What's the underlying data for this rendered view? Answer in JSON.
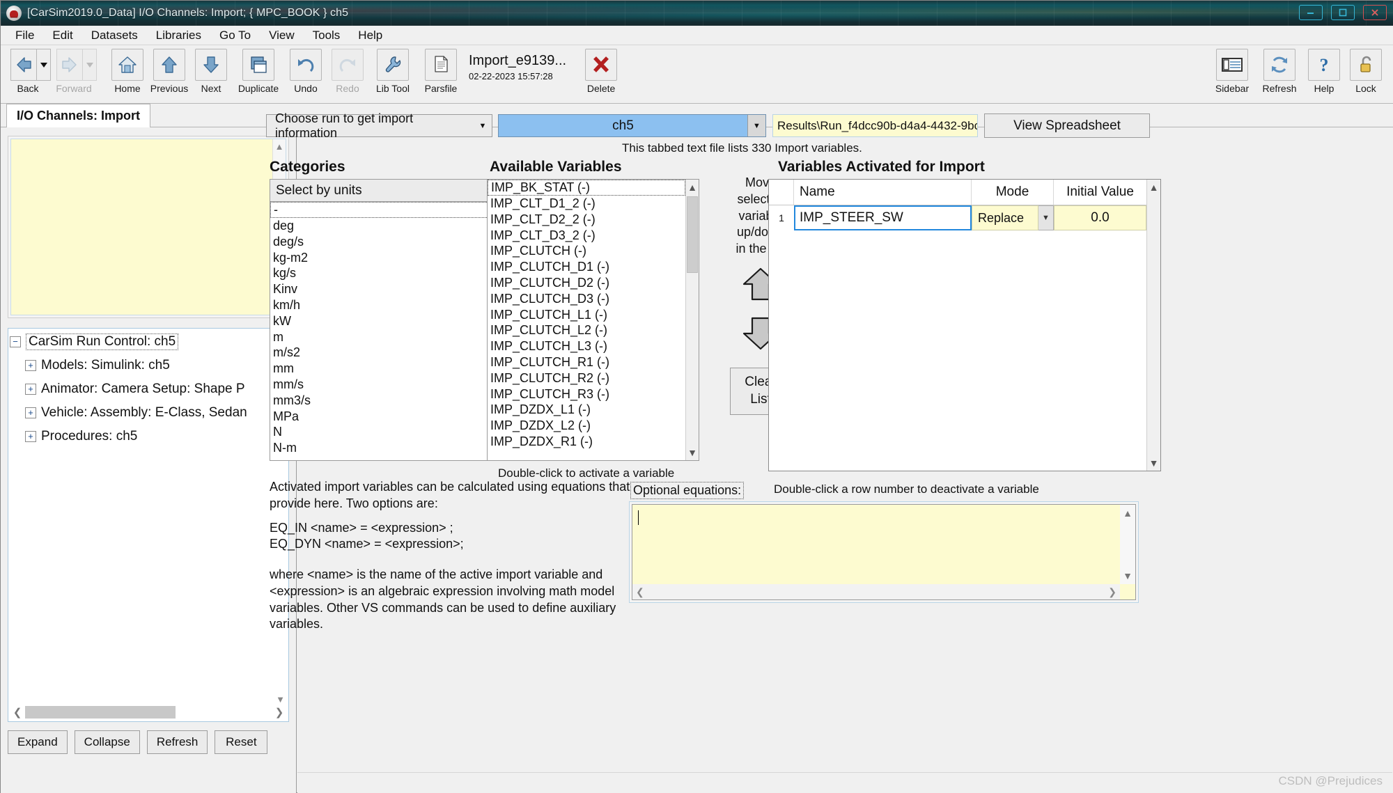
{
  "window": {
    "title": "[CarSim2019.0_Data] I/O Channels: Import; { MPC_BOOK } ch5",
    "app_icon": "carsim-logo-icon",
    "controls": [
      {
        "name": "minimize-button",
        "glyph": "minimize-icon"
      },
      {
        "name": "maximize-button",
        "glyph": "maximize-icon"
      },
      {
        "name": "close-button",
        "glyph": "close-icon"
      }
    ]
  },
  "menubar": [
    {
      "label": "File"
    },
    {
      "label": "Edit"
    },
    {
      "label": "Datasets"
    },
    {
      "label": "Libraries"
    },
    {
      "label": "Go To"
    },
    {
      "label": "View"
    },
    {
      "label": "Tools"
    },
    {
      "label": "Help"
    }
  ],
  "toolbar": {
    "left_buttons": [
      {
        "label": "Back",
        "icon": "arrow-left-icon",
        "enabled": true,
        "split": true
      },
      {
        "label": "Forward",
        "icon": "arrow-right-icon",
        "enabled": false,
        "split": true
      },
      {
        "label": "Home",
        "icon": "home-icon",
        "enabled": true
      },
      {
        "label": "Previous",
        "icon": "arrow-up-icon",
        "enabled": true
      },
      {
        "label": "Next",
        "icon": "arrow-down-icon",
        "enabled": true
      },
      {
        "label": "Duplicate",
        "icon": "duplicate-icon",
        "enabled": true
      },
      {
        "label": "Undo",
        "icon": "undo-icon",
        "enabled": true
      },
      {
        "label": "Redo",
        "icon": "redo-icon",
        "enabled": false
      },
      {
        "label": "Lib Tool",
        "icon": "wrench-icon",
        "enabled": true
      },
      {
        "label": "Parsfile",
        "icon": "document-icon",
        "enabled": true
      }
    ],
    "parsfile": {
      "name": "Import_e9139...",
      "timestamp": "02-22-2023 15:57:28"
    },
    "delete_button": {
      "label": "Delete",
      "icon": "red-x-icon"
    },
    "right_buttons": [
      {
        "label": "Sidebar",
        "icon": "sidebar-icon"
      },
      {
        "label": "Refresh",
        "icon": "refresh-icon"
      },
      {
        "label": "Help",
        "icon": "question-mark-icon"
      },
      {
        "label": "Lock",
        "icon": "padlock-icon"
      }
    ]
  },
  "tab": {
    "label": "I/O Channels: Import"
  },
  "sidebar": {
    "notes_placeholder": "",
    "tree": [
      {
        "label": "CarSim Run Control: ch5",
        "toggle": "minus",
        "level": 0,
        "selected": true
      },
      {
        "label": "Models: Simulink: ch5",
        "toggle": "plus",
        "level": 1,
        "selected": false
      },
      {
        "label": "Animator: Camera Setup: Shape P",
        "toggle": "plus",
        "level": 1,
        "selected": false
      },
      {
        "label": "Vehicle: Assembly: E-Class, Sedan",
        "toggle": "plus",
        "level": 1,
        "selected": false
      },
      {
        "label": "Procedures: ch5",
        "toggle": "plus",
        "level": 1,
        "selected": false
      }
    ],
    "buttons": [
      {
        "label": "Expand"
      },
      {
        "label": "Collapse"
      },
      {
        "label": "Refresh"
      },
      {
        "label": "Reset"
      }
    ]
  },
  "main": {
    "run_selector_label": "Choose run to get import information",
    "run_value": "ch5",
    "results_path": "Results\\Run_f4dcc90b-d4a4-4432-9bc",
    "view_spreadsheet_label": "View Spreadsheet",
    "file_note": "This tabbed text file lists 330 Import variables.",
    "categories": {
      "heading": "Categories",
      "selector_label": "Select by units",
      "items": [
        "-",
        "deg",
        "deg/s",
        "kg-m2",
        "kg/s",
        "Kinv",
        "km/h",
        "kW",
        "m",
        "m/s2",
        "mm",
        "mm/s",
        "mm3/s",
        "MPa",
        "N",
        "N-m"
      ],
      "selected_index": 0
    },
    "available": {
      "heading": "Available Variables",
      "items": [
        "IMP_BK_STAT (-)",
        "IMP_CLT_D1_2 (-)",
        "IMP_CLT_D2_2 (-)",
        "IMP_CLT_D3_2 (-)",
        "IMP_CLUTCH (-)",
        "IMP_CLUTCH_D1 (-)",
        "IMP_CLUTCH_D2 (-)",
        "IMP_CLUTCH_D3 (-)",
        "IMP_CLUTCH_L1 (-)",
        "IMP_CLUTCH_L2 (-)",
        "IMP_CLUTCH_L3 (-)",
        "IMP_CLUTCH_R1 (-)",
        "IMP_CLUTCH_R2 (-)",
        "IMP_CLUTCH_R3 (-)",
        "IMP_DZDX_L1 (-)",
        "IMP_DZDX_L2 (-)",
        "IMP_DZDX_R1 (-)"
      ],
      "selected_index": 0,
      "hint": "Double-click to activate a variable"
    },
    "move": {
      "text": "Move\nselected\nvariable\nup/down\nin the list",
      "up_icon": "arrow-up-big-icon",
      "down_icon": "arrow-down-big-icon",
      "clear_line1": "Clear",
      "clear_line2": "List"
    },
    "activated": {
      "heading": "Variables Activated for Import",
      "columns": [
        "Name",
        "Mode",
        "Initial Value"
      ],
      "rows": [
        {
          "num": "1",
          "name": "IMP_STEER_SW",
          "mode": "Replace",
          "initial": "0.0"
        }
      ],
      "hint": "Double-click a row number to deactivate a variable"
    },
    "help_text": "Activated import variables can be calculated using equations that you\nprovide here. Two options are:",
    "help_eq1": "EQ_IN <name> = <expression> ;",
    "help_eq2": "EQ_DYN <name> = <expression>;",
    "help_text2": "where <name> is the name of the active import variable and\n<expression> is an algebraic expression involving math model\nvariables. Other VS commands can be used to define auxiliary variables.",
    "equations": {
      "label": "Optional equations:",
      "value": ""
    }
  },
  "watermark": "CSDN @Prejudices",
  "colors": {
    "titlebar_teal": "#12565f",
    "combo_blue": "#8cc0f0",
    "field_yellow": "#fdfbd0",
    "accent_blue": "#2288dd",
    "delete_red": "#b31f1f"
  }
}
